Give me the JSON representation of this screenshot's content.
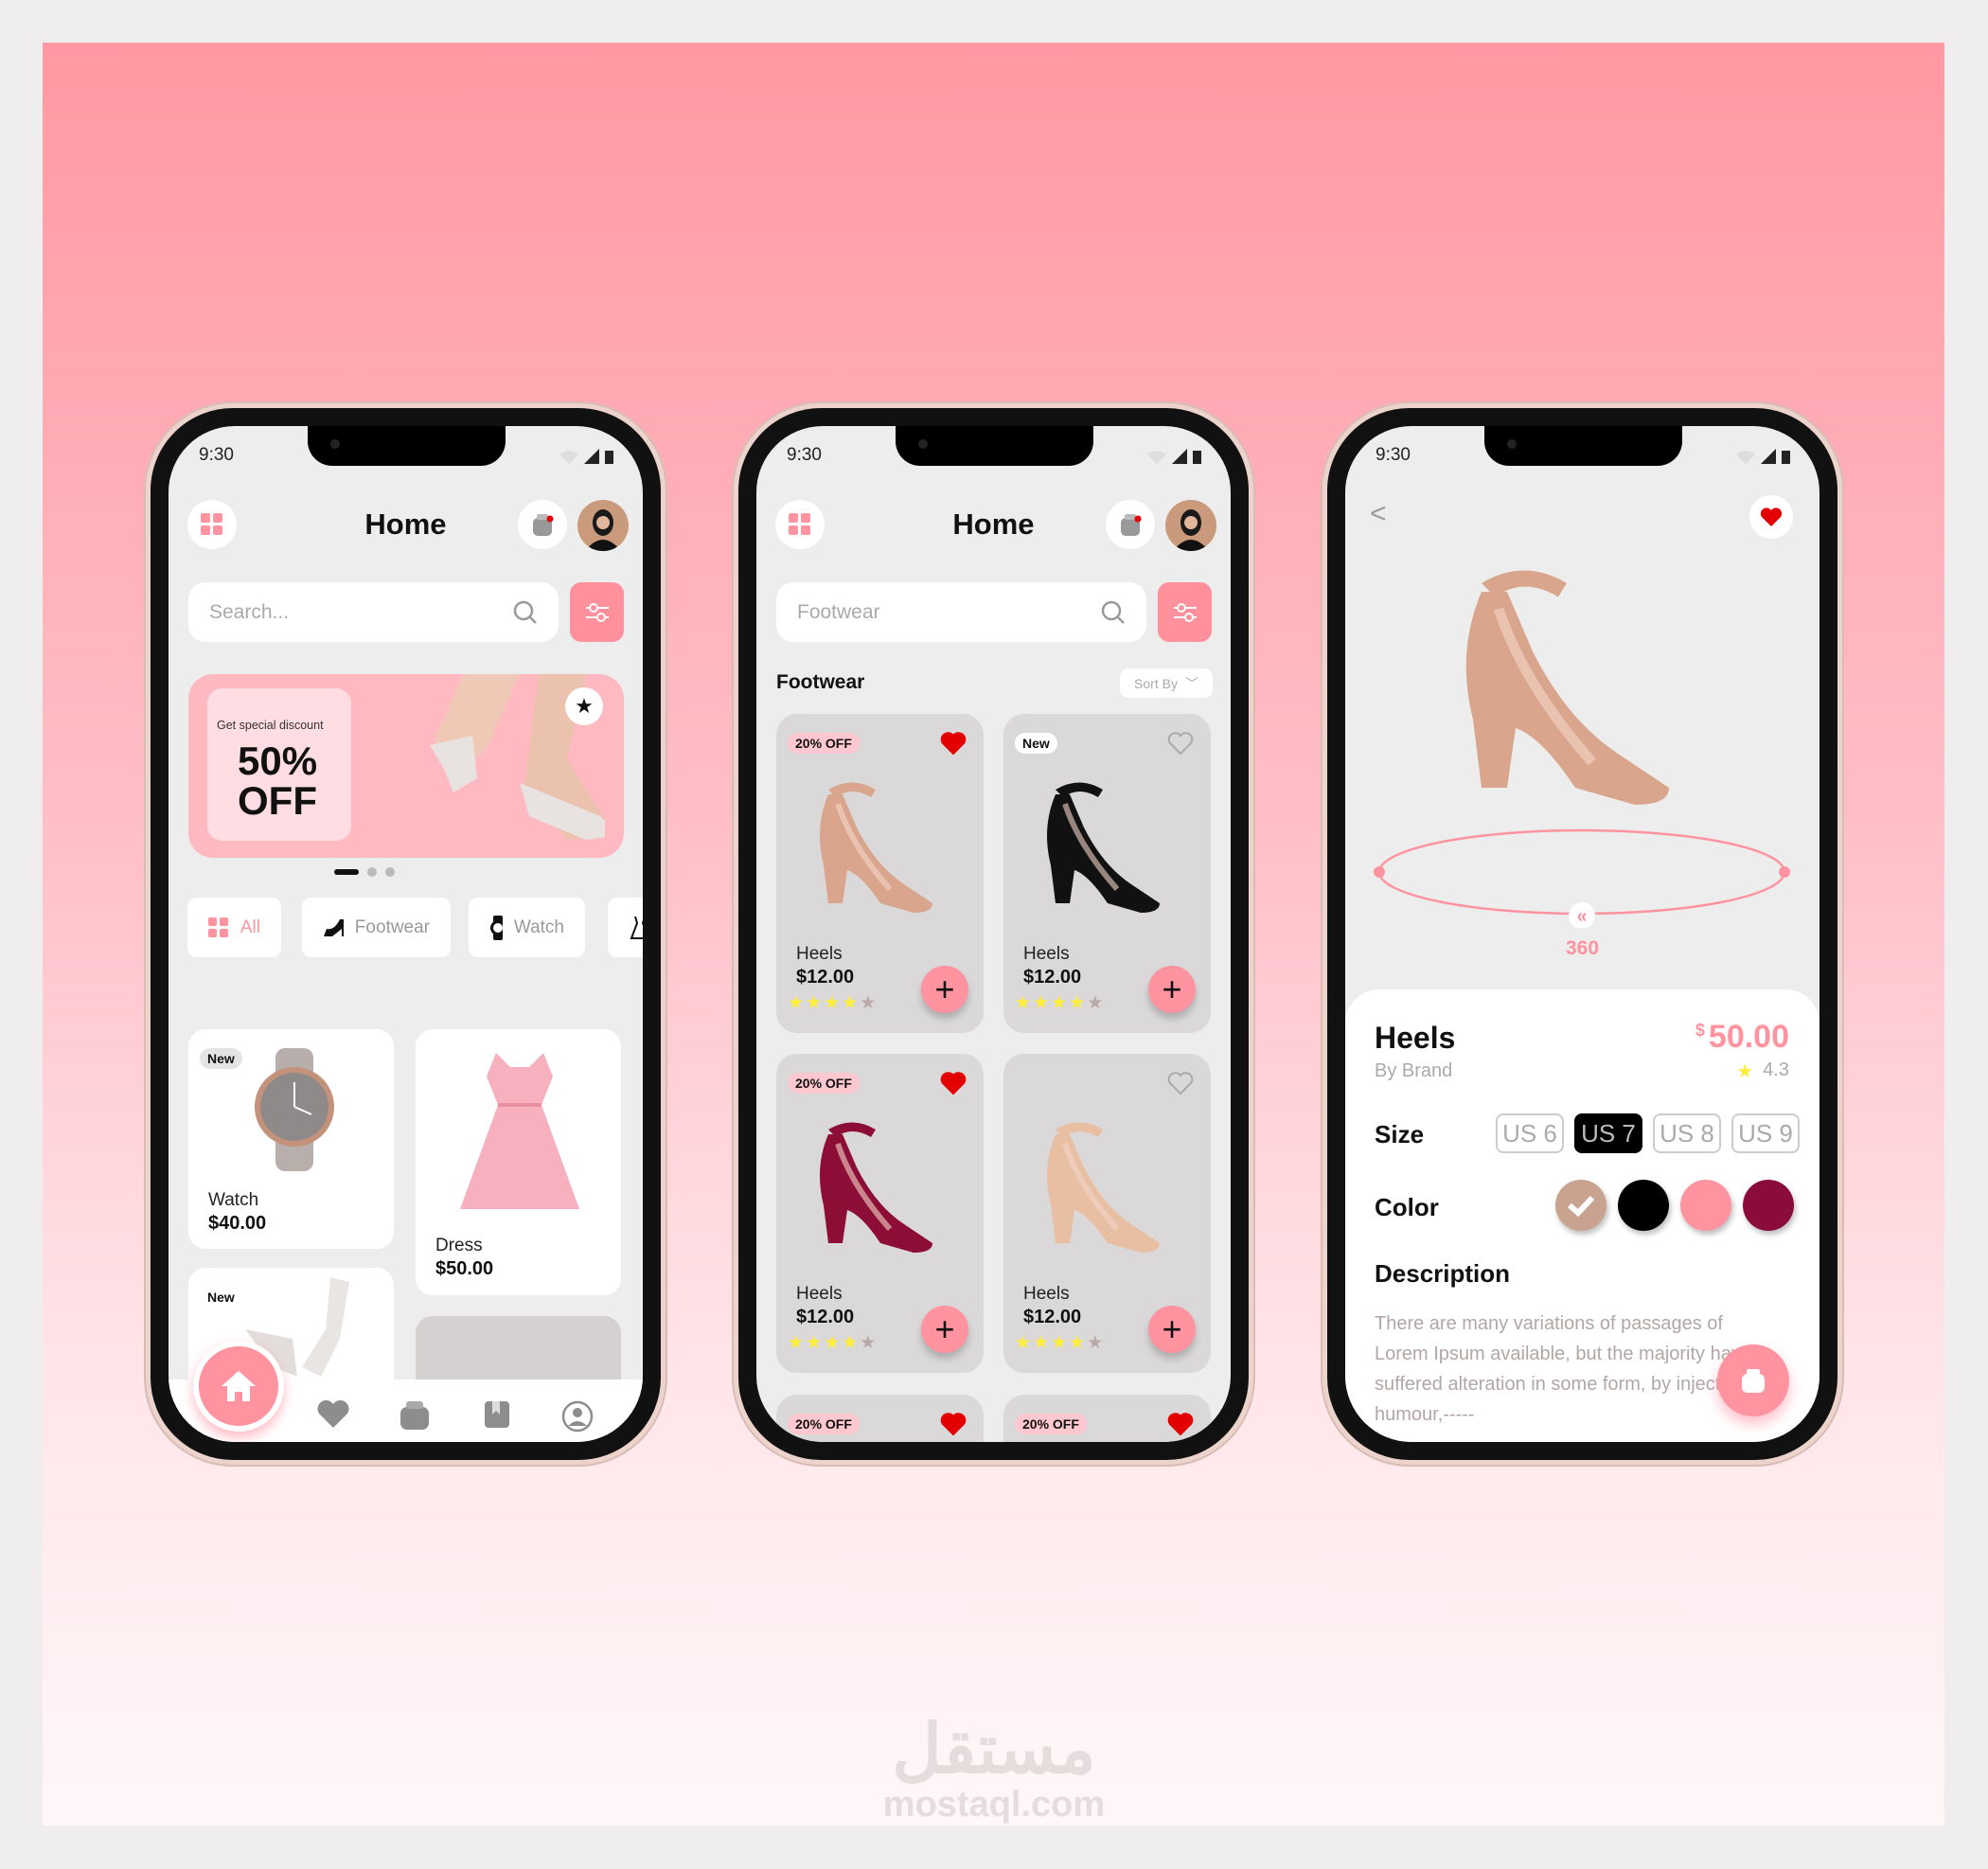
{
  "colors": {
    "accent": "#ff939f",
    "banner": "#ffb9c1",
    "heart": "#e30000",
    "star": "#ffef3a"
  },
  "status_time": "9:30",
  "phone1": {
    "title": "Home",
    "search_placeholder": "Search...",
    "banner": {
      "caption": "Get special discount",
      "line1": "50%",
      "line2": "OFF"
    },
    "carousel": {
      "pages": 3,
      "active": 1
    },
    "chips": [
      {
        "label": "All",
        "icon": "grid-icon"
      },
      {
        "label": "Footwear",
        "icon": "heel-icon"
      },
      {
        "label": "Watch",
        "icon": "watch-icon"
      },
      {
        "label": "",
        "icon": "dress-icon"
      }
    ],
    "products": [
      {
        "badge": "New",
        "name": "Watch",
        "price": "$40.00"
      },
      {
        "name": "Dress",
        "price": "$50.00"
      },
      {
        "badge": "New"
      }
    ],
    "nav": [
      "home-icon",
      "heart-icon",
      "bag-icon",
      "bookmark-icon",
      "profile-icon"
    ]
  },
  "phone2": {
    "title": "Home",
    "search_placeholder": "Footwear",
    "section": "Footwear",
    "sort_label": "Sort By",
    "products": [
      {
        "badge": "20% OFF",
        "name": "Heels",
        "price": "$12.00",
        "rating": 4,
        "liked": true,
        "color": "#d9a58c"
      },
      {
        "badge": "New",
        "name": "Heels",
        "price": "$12.00",
        "rating": 4,
        "liked": false,
        "color": "#111111"
      },
      {
        "badge": "20% OFF",
        "name": "Heels",
        "price": "$12.00",
        "rating": 4,
        "liked": true,
        "color": "#8c0d35"
      },
      {
        "name": "Heels",
        "price": "$12.00",
        "rating": 4,
        "liked": false,
        "color": "#e8bfa2"
      },
      {
        "badge": "20% OFF",
        "liked": true
      },
      {
        "badge": "20% OFF",
        "liked": true
      }
    ]
  },
  "phone3": {
    "back": "<",
    "rotate_label": "360",
    "name": "Heels",
    "brand": "By Brand",
    "currency": "$",
    "price": "50.00",
    "rating": "4.3",
    "size_label": "Size",
    "sizes": [
      "US 6",
      "US 7",
      "US 8",
      "US 9"
    ],
    "selected_size": "US 7",
    "color_label": "Color",
    "swatches": [
      "#c9a38f",
      "#000000",
      "#ff939f",
      "#8a0c3a"
    ],
    "selected_color": "#c9a38f",
    "description_label": "Description",
    "description": [
      "There are many variations of passages of",
      "Lorem Ipsum available, but the majority have",
      "suffered alteration in some form, by injected",
      "humour,-----"
    ]
  },
  "watermark": {
    "logo": "مستقل",
    "site": "mostaql.com"
  }
}
